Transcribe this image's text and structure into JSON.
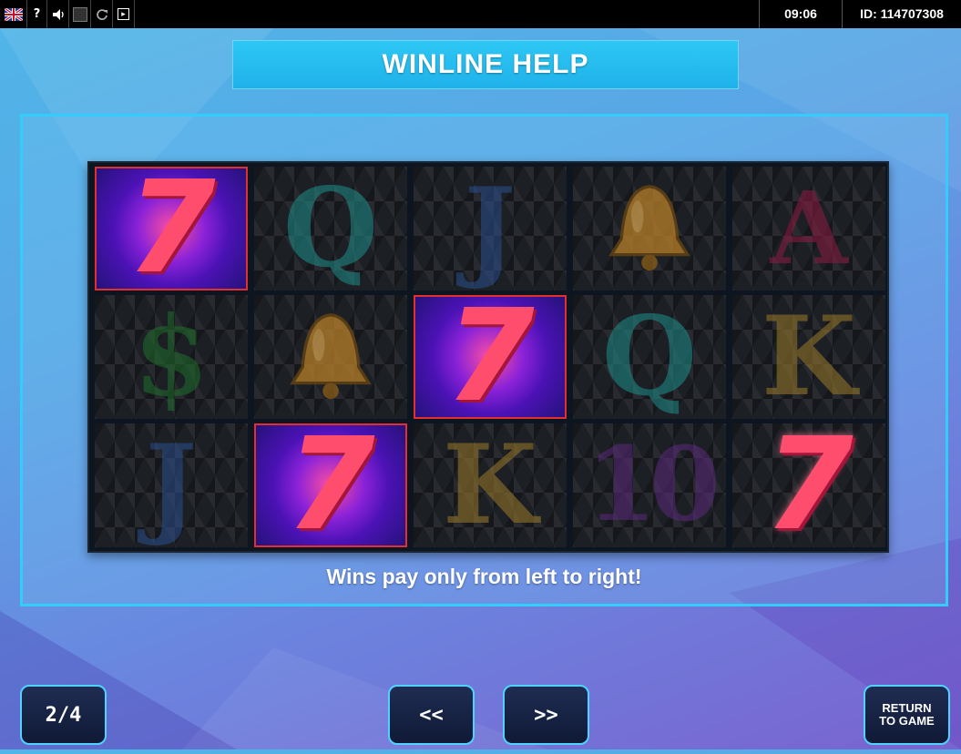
{
  "status_bar": {
    "icons": [
      "uk-flag-icon",
      "help-icon",
      "sound-icon",
      "fullscreen-icon",
      "reload-icon",
      "menu-icon"
    ],
    "help_glyph": "?",
    "time": "09:06",
    "session_id": "ID: 114707308"
  },
  "title": "WINLINE HELP",
  "reels": {
    "rows": [
      [
        {
          "symbol": "seven",
          "glyph": "7",
          "win": true
        },
        {
          "symbol": "queen",
          "glyph": "Q",
          "win": false
        },
        {
          "symbol": "jack",
          "glyph": "J",
          "win": false
        },
        {
          "symbol": "bell",
          "glyph": "",
          "win": false
        },
        {
          "symbol": "ace",
          "glyph": "A",
          "win": false
        }
      ],
      [
        {
          "symbol": "dollar",
          "glyph": "$",
          "win": false
        },
        {
          "symbol": "bell",
          "glyph": "",
          "win": false
        },
        {
          "symbol": "seven",
          "glyph": "7",
          "win": true
        },
        {
          "symbol": "queen",
          "glyph": "Q",
          "win": false
        },
        {
          "symbol": "king",
          "glyph": "K",
          "win": false
        }
      ],
      [
        {
          "symbol": "jack",
          "glyph": "J",
          "win": false
        },
        {
          "symbol": "seven",
          "glyph": "7",
          "win": true
        },
        {
          "symbol": "king",
          "glyph": "K",
          "win": false
        },
        {
          "symbol": "ten",
          "glyph": "10",
          "win": false
        },
        {
          "symbol": "seven",
          "glyph": "7",
          "win": false
        }
      ]
    ]
  },
  "caption": "Wins pay only from left to right!",
  "footer": {
    "page_indicator": "2/4",
    "prev_label": "<<",
    "next_label": ">>",
    "return_label_line1": "RETURN",
    "return_label_line2": "TO GAME"
  },
  "colors": {
    "accent": "#34cdfb",
    "title_bg": "#1fb2ea",
    "win_frame": "#e23030",
    "button_bg": "#101a36"
  }
}
